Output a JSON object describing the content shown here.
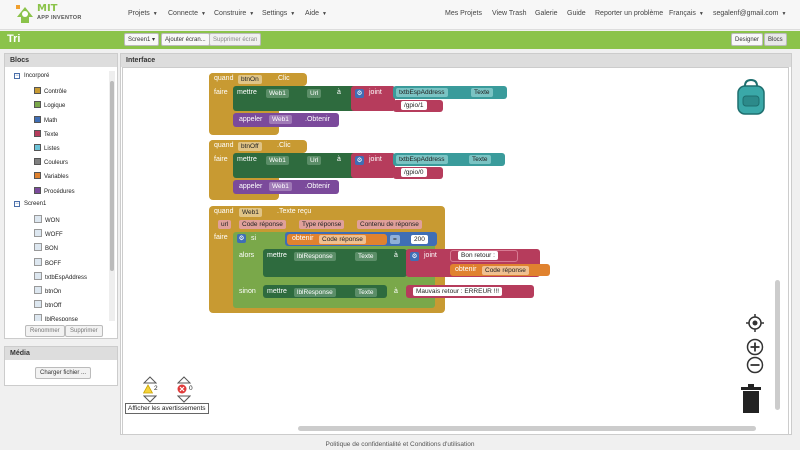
{
  "app": {
    "logo_top": "MIT",
    "logo_bottom": "APP INVENTOR"
  },
  "menu": {
    "projets": "Projets",
    "connecte": "Connecte",
    "construire": "Construire",
    "parametres": "Settings",
    "aide": "Aide"
  },
  "right_menu": {
    "mes_projets": "Mes Projets",
    "view_trash": "View Trash",
    "galerie": "Galerie",
    "guide": "Guide",
    "report": "Reporter un problème",
    "lang": "Français",
    "email": "segalenf@gmail.com"
  },
  "toolbar": {
    "title": "Tri",
    "screen_select": "Screen1 ▾",
    "add_screen": "Ajouter écran...",
    "remove_screen": "Supprimer écran",
    "designer": "Designer",
    "blocs": "Blocs"
  },
  "blocs_panel": {
    "header": "Blocs",
    "builtin": "Incorporé",
    "builtin_items": [
      "Contrôle",
      "Logique",
      "Math",
      "Texte",
      "Listes",
      "Couleurs",
      "Variables",
      "Procédures"
    ],
    "builtin_colors": [
      "#c89a32",
      "#7aa84a",
      "#3f6eb5",
      "#b63c5c",
      "#6cc3d8",
      "#7f7f7f",
      "#e0822f",
      "#7b4a9b"
    ],
    "screen": "Screen1",
    "components": [
      "WON",
      "WOFF",
      "BON",
      "BOFF",
      "txtbEspAddress",
      "btnOn",
      "btnOff",
      "lblResponse"
    ],
    "rename": "Renommer",
    "delete": "Supprimer"
  },
  "media_panel": {
    "header": "Média",
    "upload": "Charger fichier ..."
  },
  "workspace": {
    "header": "Interface",
    "warnings_count": "2",
    "errors_count": "0",
    "show_warnings": "Afficher les avertissements"
  },
  "blocks": {
    "b1": {
      "quand": "quand",
      "comp": "btnOn",
      "event": ".Clic",
      "faire": "faire",
      "mettre": "mettre",
      "web": "Web1",
      "prop": "Url",
      "a": "à",
      "joint": "joint",
      "txt": "txtbEspAddress",
      "texte": "Texte",
      "str": "/gpio/1",
      "appeler": "appeler",
      "web2": "Web1",
      "method": ".Obtenir"
    },
    "b2": {
      "quand": "quand",
      "comp": "btnOff",
      "event": ".Clic",
      "faire": "faire",
      "mettre": "mettre",
      "web": "Web1",
      "prop": "Url",
      "a": "à",
      "joint": "joint",
      "txt": "txtbEspAddress",
      "texte": "Texte",
      "str": "/gpio/0",
      "appeler": "appeler",
      "web2": "Web1",
      "method": ".Obtenir"
    },
    "b3": {
      "quand": "quand",
      "comp": "Web1",
      "event": ".Texte reçu",
      "p_url": "url",
      "p_code": "Code réponse",
      "p_type": "Type réponse",
      "p_content": "Contenu de réponse",
      "faire": "faire",
      "si": "si",
      "obtenir": "obtenir",
      "code_var": "Code réponse",
      "eq": "=",
      "num": "200",
      "alors": "alors",
      "mettre": "mettre",
      "lbl": "lblResponse",
      "texte": "Texte",
      "a": "à",
      "joint": "joint",
      "bon": "Bon retour :",
      "obtenir2": "obtenir",
      "code_var2": "Code réponse",
      "sinon": "sinon",
      "mettre2": "mettre",
      "lbl2": "lblResponse",
      "texte2": "Texte",
      "a2": "à",
      "err": "Mauvais retour : ERREUR !!!"
    }
  },
  "footer": "Politique de confidentialité et Conditions d'utilisation",
  "colors": {
    "accent": "#8bc34a",
    "control": "#c89a32",
    "component": "#2e6b3e",
    "text": "#b63c5c",
    "teal": "#3a9b9b"
  }
}
